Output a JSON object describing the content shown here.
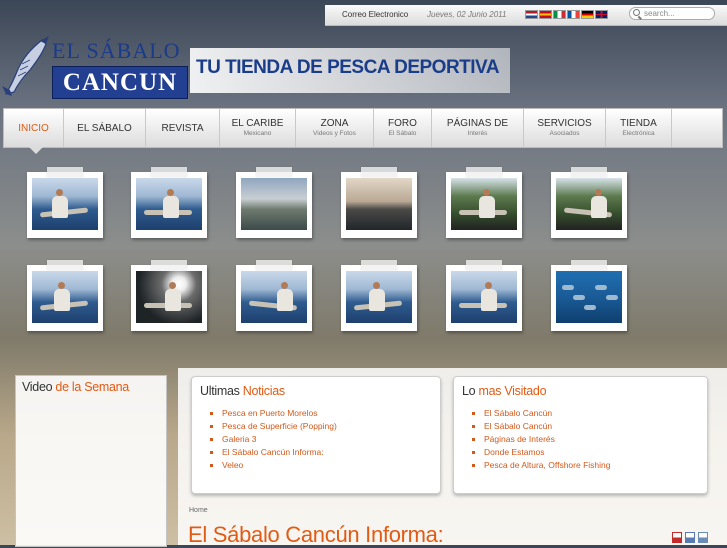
{
  "topbar": {
    "email_link": "Correo Electronico",
    "date": "Jueves, 02 Junio 2011",
    "flags": [
      {
        "name": "netherlands-flag-icon",
        "colors": [
          "#ae1c28",
          "#ffffff",
          "#21468b"
        ]
      },
      {
        "name": "spain-flag-icon",
        "colors": [
          "#c60b1e",
          "#ffc400",
          "#c60b1e"
        ]
      },
      {
        "name": "italy-flag-icon",
        "colors": [
          "#009246",
          "#ffffff",
          "#ce2b37"
        ]
      },
      {
        "name": "france-flag-icon",
        "colors": [
          "#0055a4",
          "#ffffff",
          "#ef4135"
        ]
      },
      {
        "name": "germany-flag-icon",
        "colors": [
          "#000000",
          "#dd0000",
          "#ffce00"
        ]
      },
      {
        "name": "uk-flag-icon",
        "colors": [
          "#012169",
          "#ffffff",
          "#c8102e"
        ]
      }
    ],
    "search_placeholder": "search..."
  },
  "header": {
    "logo_line1": "EL SÁBALO",
    "logo_line2": "CANCUN",
    "tagline": "TU TIENDA DE PESCA DEPORTIVA"
  },
  "nav": {
    "items": [
      {
        "label": "INICIO",
        "sub": ""
      },
      {
        "label": "EL SÁBALO",
        "sub": ""
      },
      {
        "label": "REVISTA",
        "sub": ""
      },
      {
        "label": "EL CARIBE",
        "sub": "Mexicano"
      },
      {
        "label": "ZONA",
        "sub": "Videos y Fotos"
      },
      {
        "label": "FORO",
        "sub": "El Sábalo"
      },
      {
        "label": "PÁGINAS DE",
        "sub": "Interés"
      },
      {
        "label": "SERVICIOS",
        "sub": "Asociados"
      },
      {
        "label": "TIENDA",
        "sub": "Electrónica"
      }
    ]
  },
  "gallery": {
    "photos": [
      {
        "scene": "sea"
      },
      {
        "scene": "sea"
      },
      {
        "scene": "sky"
      },
      {
        "scene": "dusk"
      },
      {
        "scene": "forest"
      },
      {
        "scene": "forest"
      },
      {
        "scene": "sea"
      },
      {
        "scene": "dark"
      },
      {
        "scene": "sea"
      },
      {
        "scene": "sea"
      },
      {
        "scene": "sea"
      },
      {
        "scene": "under"
      }
    ]
  },
  "video_box": {
    "title_plain": "Video ",
    "title_accent": "de la Semana"
  },
  "news_box": {
    "title_plain": "Ultimas ",
    "title_accent": "Noticias",
    "items": [
      "Pesca en Puerto Morelos",
      "Pesca de Superficie (Popping)",
      "Galeria 3",
      "El Sábalo Cancún Informa:",
      "Veleo"
    ]
  },
  "popular_box": {
    "title_plain": "Lo ",
    "title_accent": "mas Visitado",
    "items": [
      "El Sábalo Cancún",
      "El Sábalo Cancún",
      "Páginas de Interés",
      "Donde Estamos",
      "Pesca de Altura, Offshore Fishing"
    ]
  },
  "breadcrumb": "Home",
  "article_title": "El Sábalo Cancún Informa:",
  "tools": [
    {
      "name": "pdf-icon",
      "color": "#c62b2b"
    },
    {
      "name": "print-icon",
      "color": "#5a7bb1"
    },
    {
      "name": "email-icon",
      "color": "#6a8cb6"
    }
  ],
  "colors": {
    "accent": "#e15b14",
    "brand": "#233f91"
  }
}
